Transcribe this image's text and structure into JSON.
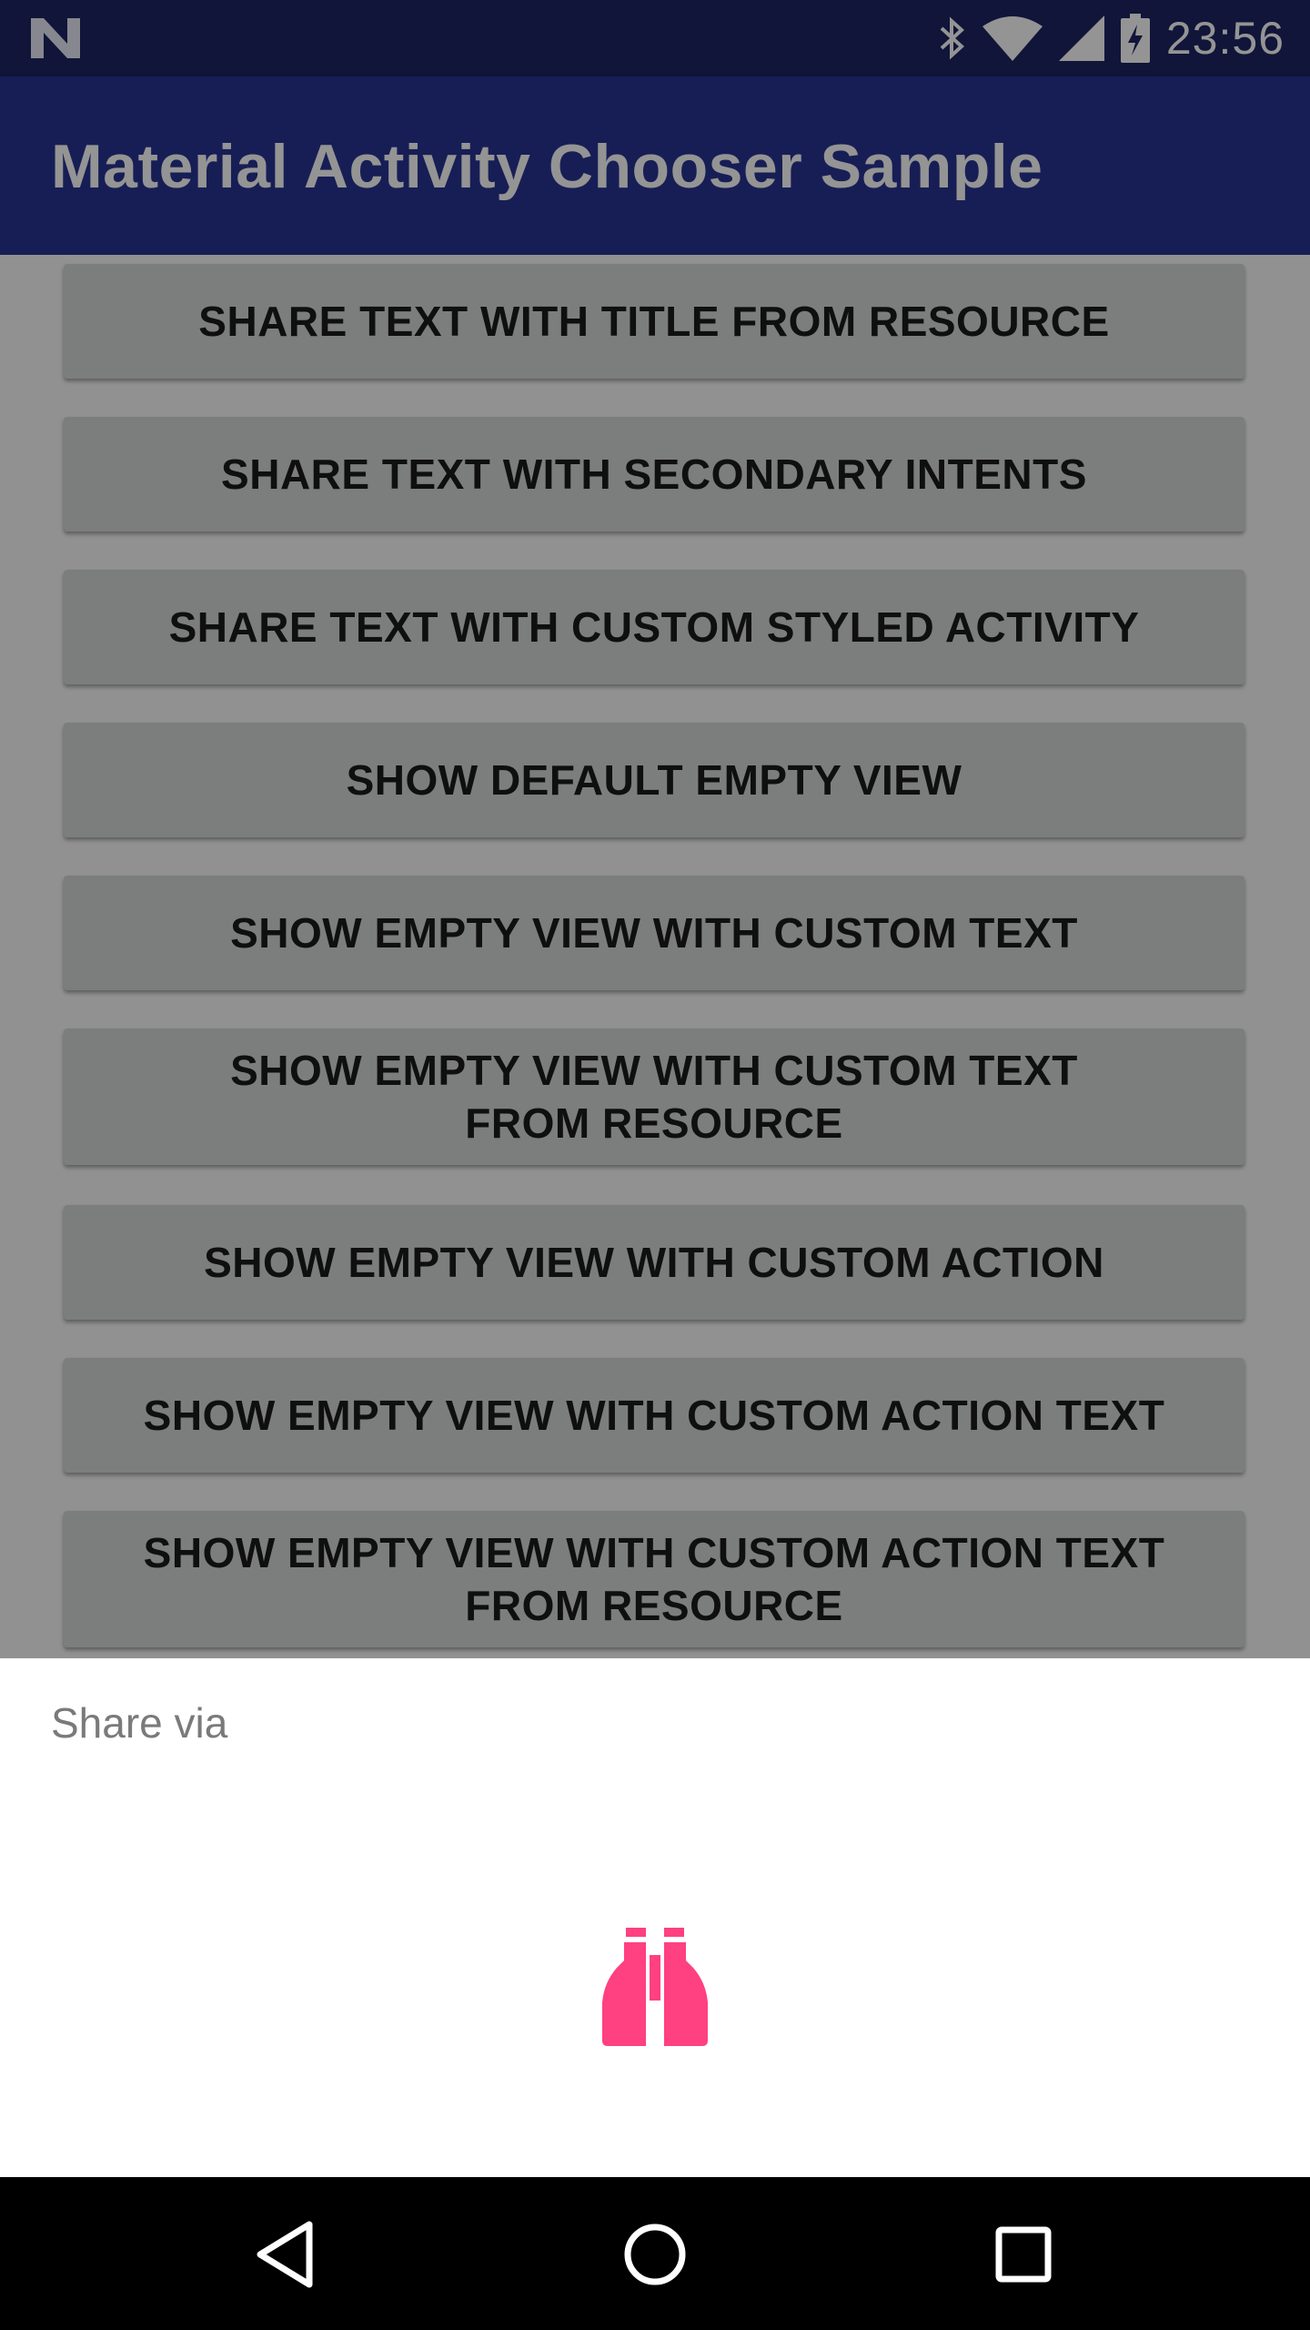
{
  "status_bar": {
    "time": "23:56",
    "icons": [
      "notification-n-icon",
      "bluetooth-icon",
      "wifi-icon",
      "signal-icon",
      "battery-charging-icon"
    ]
  },
  "app_bar": {
    "title": "Material Activity Chooser Sample"
  },
  "buttons": [
    "SHARE TEXT WITH TITLE FROM RESOURCE",
    "SHARE TEXT WITH SECONDARY INTENTS",
    "SHARE TEXT WITH CUSTOM STYLED ACTIVITY",
    "SHOW DEFAULT EMPTY VIEW",
    "SHOW EMPTY VIEW WITH CUSTOM TEXT",
    "SHOW EMPTY VIEW WITH CUSTOM TEXT FROM RESOURCE",
    "SHOW EMPTY VIEW WITH CUSTOM ACTION",
    "SHOW EMPTY VIEW WITH CUSTOM ACTION TEXT",
    "SHOW EMPTY VIEW WITH CUSTOM ACTION TEXT FROM RESOURCE"
  ],
  "chooser": {
    "title": "Share via",
    "empty_icon": "binoculars-icon",
    "accent_color": "#ff4081"
  },
  "nav_bar": {
    "icons": [
      "back-icon",
      "home-icon",
      "recents-icon"
    ]
  },
  "colors": {
    "status_bar": "#1d2563",
    "app_bar": "#283593",
    "button": "#d6d7d7",
    "scrim": "rgba(0,0,0,0.42)"
  }
}
